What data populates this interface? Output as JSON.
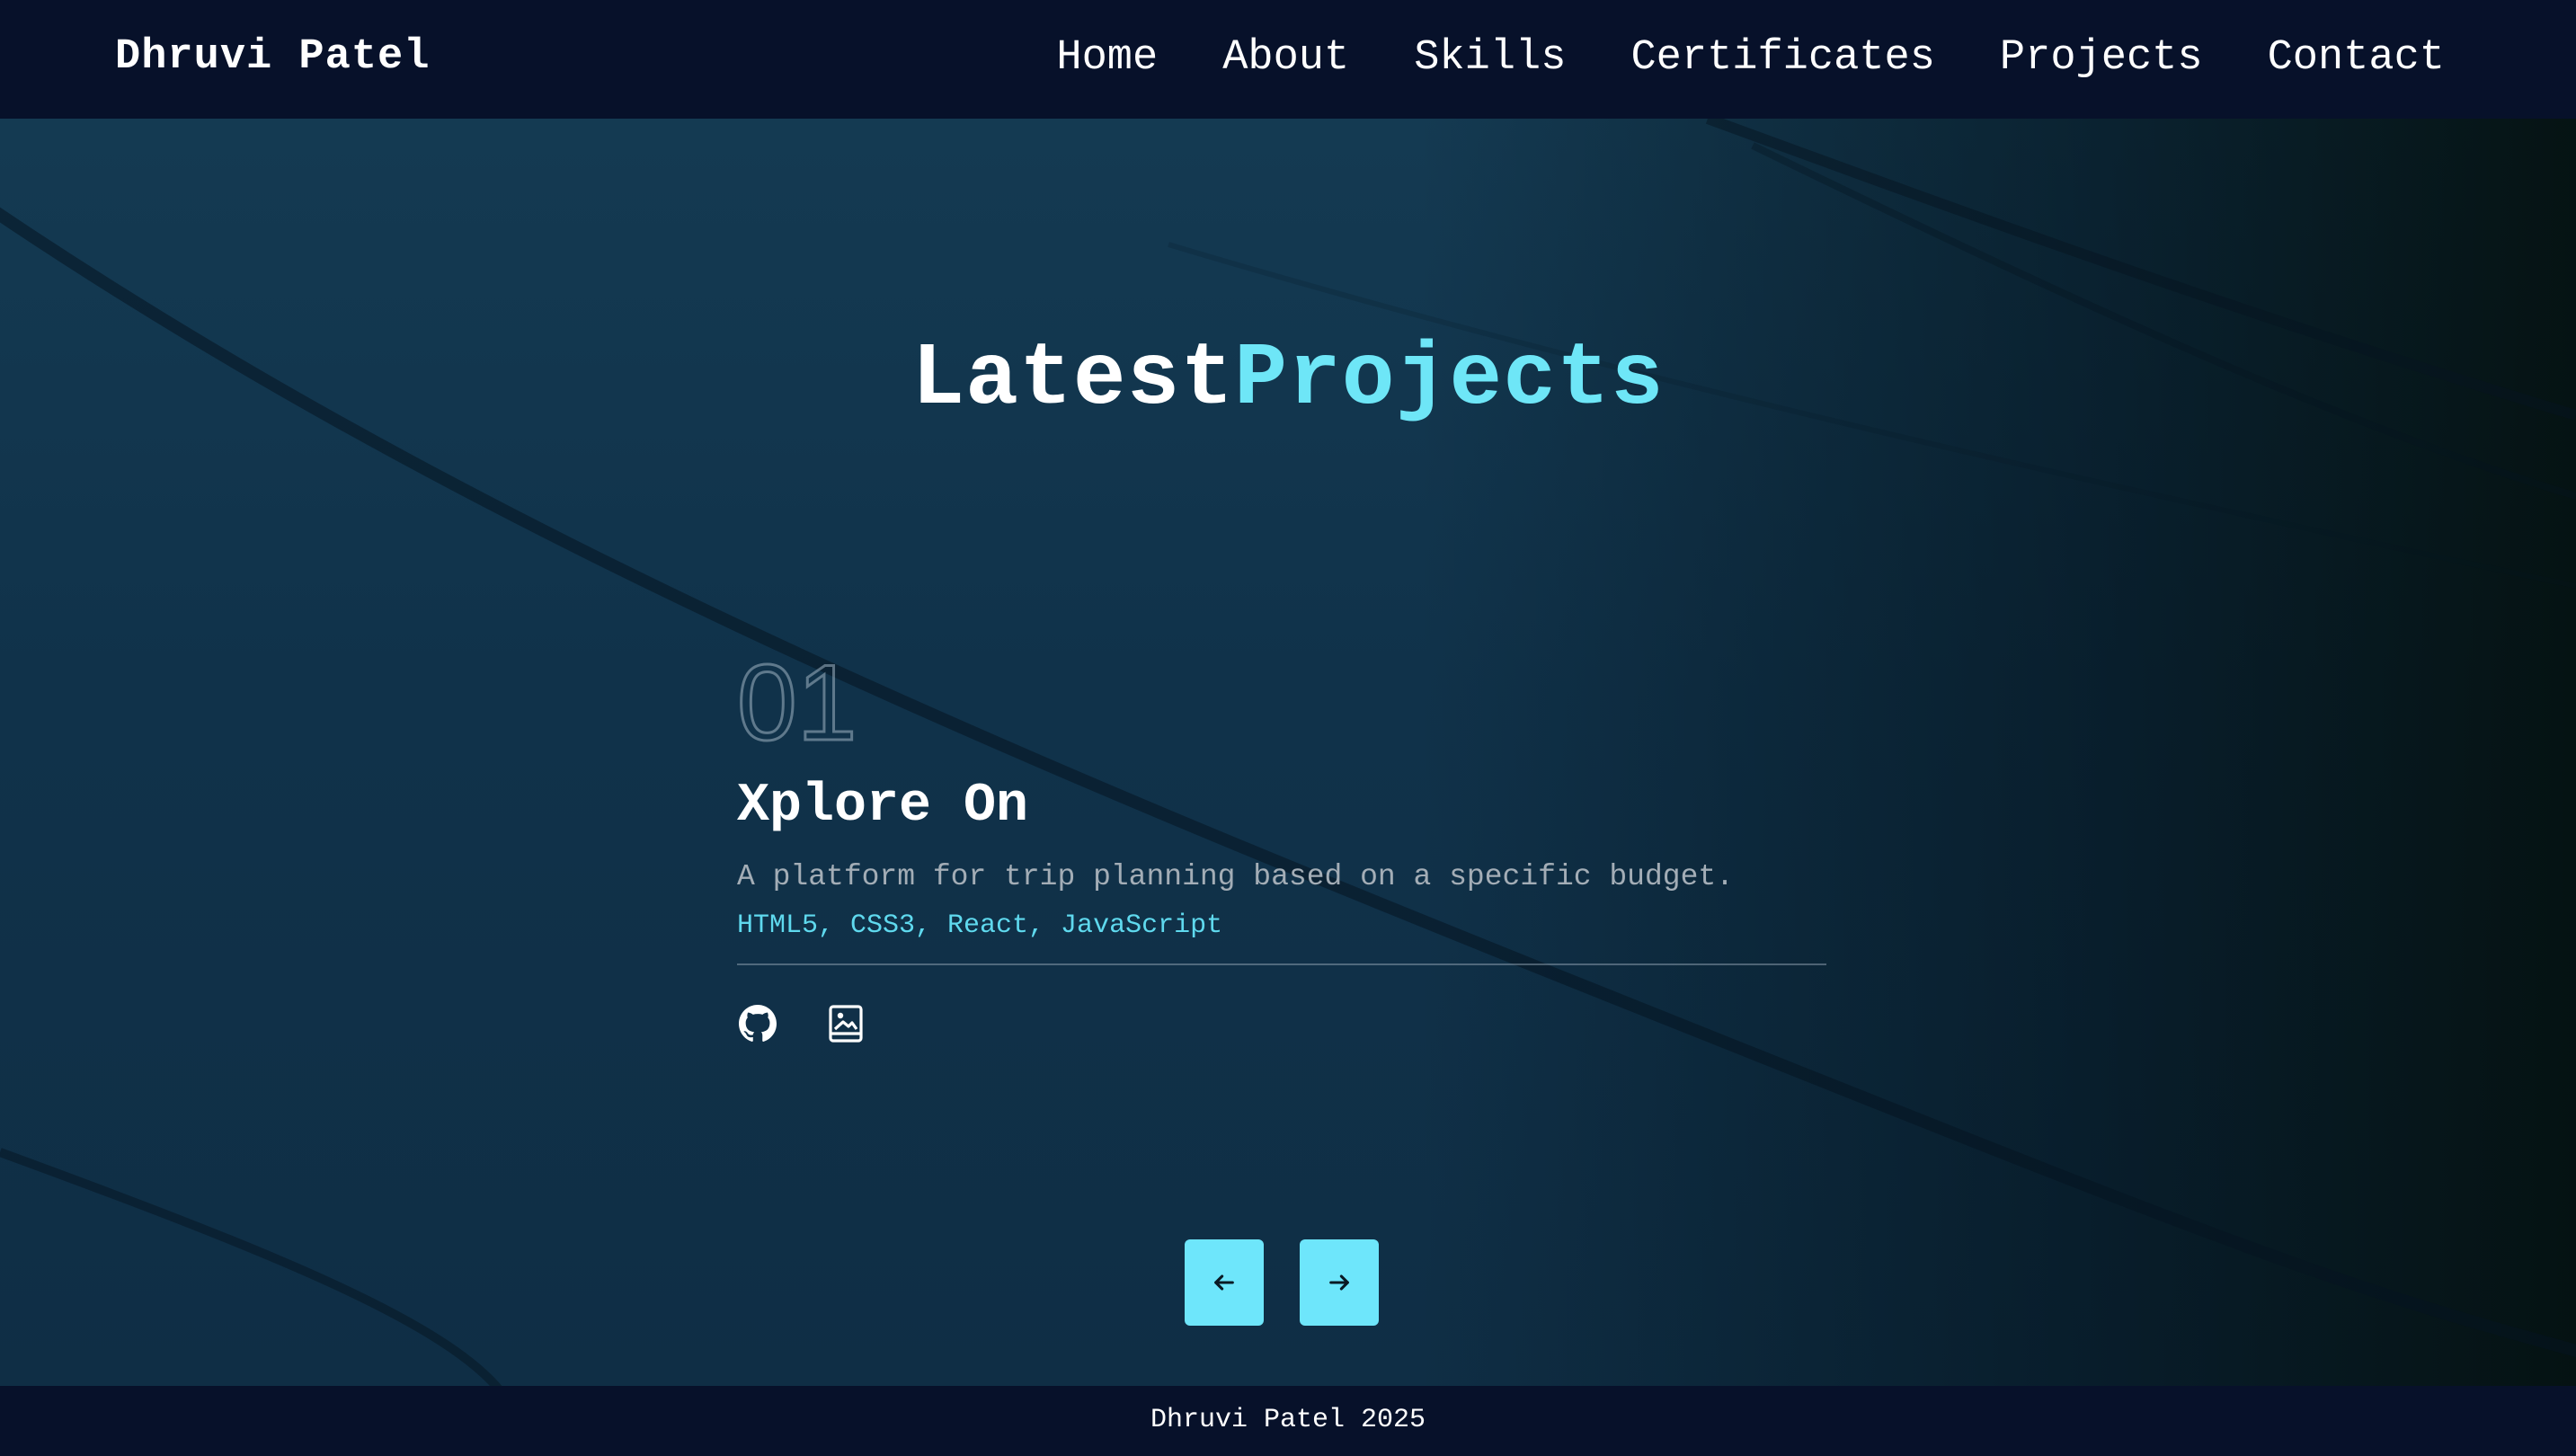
{
  "nav": {
    "brand": "Dhruvi Patel",
    "links": [
      "Home",
      "About",
      "Skills",
      "Certificates",
      "Projects",
      "Contact"
    ]
  },
  "section": {
    "title_part1": "Latest",
    "title_part2": "Projects",
    "colors": {
      "accent": "#6ee6f7",
      "background": "#10324a",
      "nav_background": "#07112a"
    }
  },
  "project": {
    "number": "01",
    "name": "Xplore On",
    "description": "A platform for trip planning based on a specific budget.",
    "tech_stack": "HTML5, CSS3, React, JavaScript",
    "icons": [
      "github-icon",
      "gallery-icon"
    ]
  },
  "slider": {
    "prev_icon": "arrow-left-icon",
    "next_icon": "arrow-right-icon"
  },
  "footer": {
    "text": "Dhruvi Patel 2025"
  }
}
